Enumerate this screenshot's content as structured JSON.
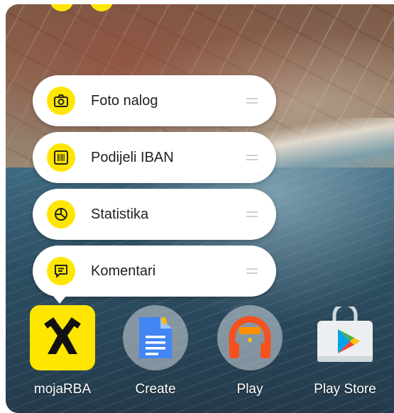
{
  "shortcuts": [
    {
      "label": "Foto nalog",
      "icon": "camera-icon"
    },
    {
      "label": "Podijeli IBAN",
      "icon": "barcode-icon"
    },
    {
      "label": "Statistika",
      "icon": "pie-chart-icon"
    },
    {
      "label": "Komentari",
      "icon": "comment-icon"
    }
  ],
  "dock": [
    {
      "label": "mojaRBA",
      "icon": "raiffeisen-logo-icon"
    },
    {
      "label": "Create",
      "icon": "google-docs-icon"
    },
    {
      "label": "Play",
      "icon": "play-music-icon"
    },
    {
      "label": "Play Store",
      "icon": "play-store-icon"
    }
  ],
  "colors": {
    "accent": "#ffe600",
    "menu_bg": "#ffffff",
    "label_text": "#212121"
  }
}
